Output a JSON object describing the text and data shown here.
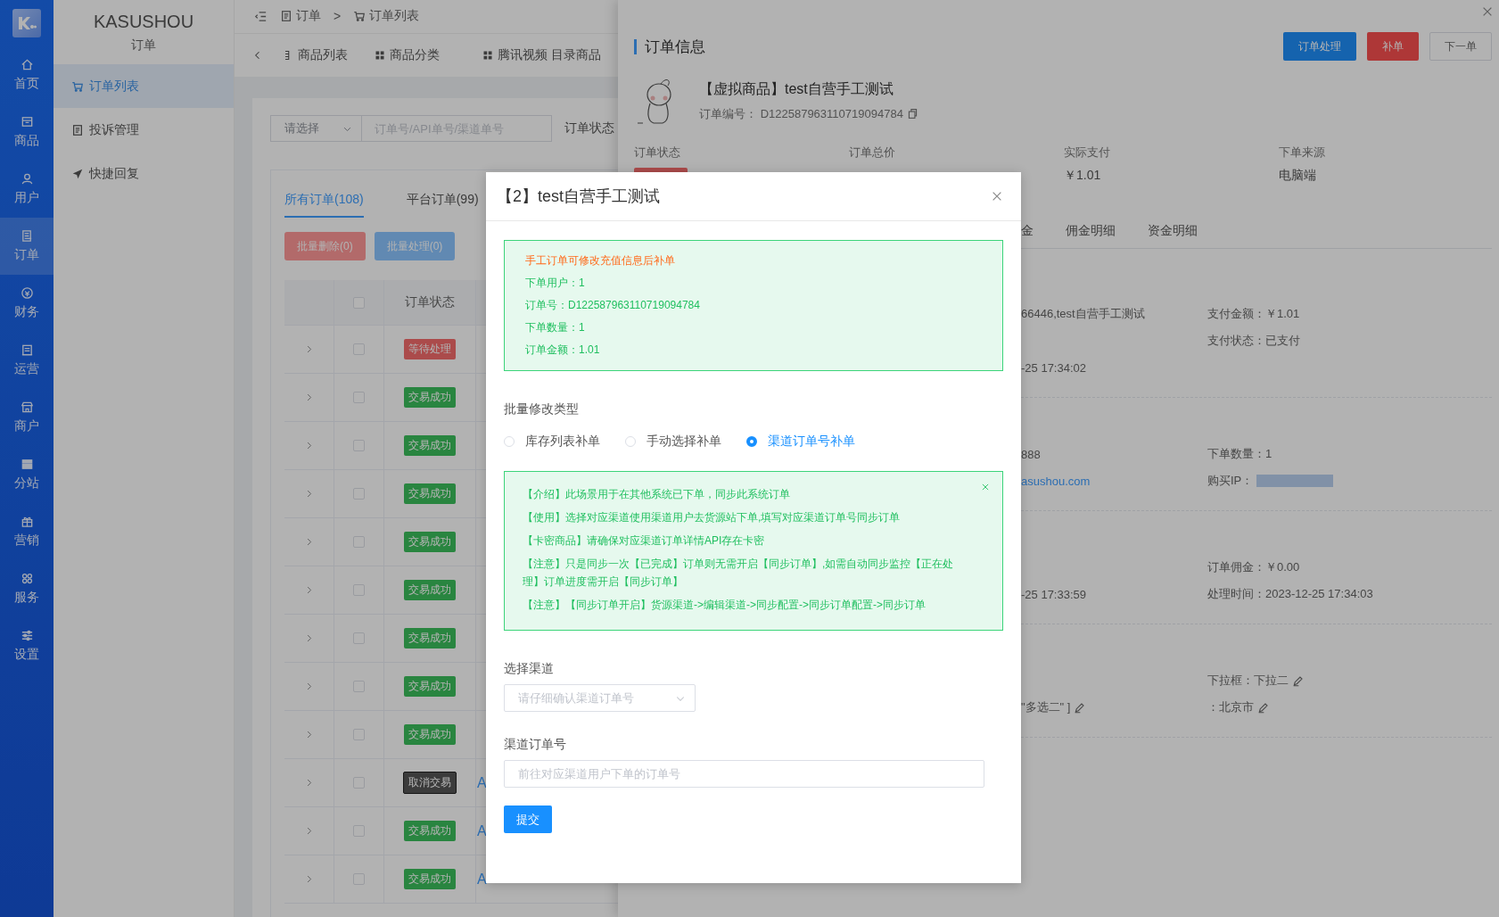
{
  "rail": {
    "items": [
      {
        "label": "首页",
        "selected": false
      },
      {
        "label": "商品",
        "selected": false
      },
      {
        "label": "用户",
        "selected": false
      },
      {
        "label": "订单",
        "selected": true
      },
      {
        "label": "财务",
        "selected": false
      },
      {
        "label": "运营",
        "selected": false
      },
      {
        "label": "商户",
        "selected": false
      },
      {
        "label": "分站",
        "selected": false
      },
      {
        "label": "营销",
        "selected": false
      },
      {
        "label": "服务",
        "selected": false
      },
      {
        "label": "设置",
        "selected": false
      }
    ]
  },
  "subnav": {
    "title": "KASUSHOU",
    "subtitle": "订单",
    "items": [
      {
        "label": "订单列表",
        "selected": true
      },
      {
        "label": "投诉管理",
        "selected": false
      },
      {
        "label": "快捷回复",
        "selected": false
      }
    ]
  },
  "breadcrumb": [
    "订单",
    "订单列表"
  ],
  "breadcrumb_separator": ">",
  "page_tabs": [
    "商品列表",
    "商品分类",
    "腾讯视频 目录商品"
  ],
  "filters": {
    "select_placeholder": "请选择",
    "search_placeholder": "订单号/API单号/渠道单号",
    "status_label": "订单状态"
  },
  "order_tabs": [
    {
      "label": "所有订单(108)",
      "selected": true
    },
    {
      "label": "平台订单(99)",
      "selected": false
    }
  ],
  "batch_buttons": [
    {
      "label": "批量删除(0)",
      "kind": "danger"
    },
    {
      "label": "批量处理(0)",
      "kind": "primary"
    }
  ],
  "table": {
    "columns": [
      "订单状态"
    ],
    "header_checked": false,
    "rows": [
      {
        "status": "等待处理",
        "kind": "pending",
        "checked": false
      },
      {
        "status": "交易成功",
        "kind": "success",
        "checked": false
      },
      {
        "status": "交易成功",
        "kind": "success",
        "checked": false
      },
      {
        "status": "交易成功",
        "kind": "success",
        "checked": false
      },
      {
        "status": "交易成功",
        "kind": "success",
        "checked": false
      },
      {
        "status": "交易成功",
        "kind": "success",
        "checked": false
      },
      {
        "status": "交易成功",
        "kind": "success",
        "checked": false
      },
      {
        "status": "交易成功",
        "kind": "success",
        "checked": false
      },
      {
        "status": "交易成功",
        "kind": "success",
        "checked": false
      },
      {
        "status": "取消交易",
        "kind": "cancelled",
        "checked": false,
        "column_4": "A"
      },
      {
        "status": "交易成功",
        "kind": "success",
        "checked": false,
        "column_4": "A"
      },
      {
        "status": "交易成功",
        "kind": "success",
        "checked": false,
        "column_4": "A"
      }
    ]
  },
  "drawer": {
    "title": "订单信息",
    "buttons": [
      {
        "label": "订单处理",
        "kind": "primary"
      },
      {
        "label": "补单",
        "kind": "danger"
      },
      {
        "label": "下一单",
        "kind": "default"
      }
    ],
    "product": {
      "name": "【虚拟商品】test自营手工测试",
      "order_no_label": "订单编号：",
      "order_no": "D122587963110719094784"
    },
    "stats": [
      {
        "label": "订单状态",
        "kind": "tag"
      },
      {
        "label": "订单总价",
        "kind": "text"
      },
      {
        "label": "实际支付",
        "kind": "text",
        "value": "￥1.01"
      },
      {
        "label": "下单来源",
        "kind": "text",
        "value": "电脑端"
      }
    ],
    "tabs": [
      "金",
      "佣金明细",
      "资金明细"
    ],
    "sections": [
      [
        {
          "left": {
            "text": "66446,test自营手工测试",
            "kind": "text"
          },
          "right": {
            "text": "支付金额：￥1.01",
            "kind": "text"
          }
        },
        {
          "right": {
            "text": "支付状态：已支付",
            "kind": "text"
          }
        },
        {
          "left": {
            "text": "-25 17:34:02",
            "kind": "text"
          }
        }
      ],
      [
        {
          "left": {
            "text": "888",
            "kind": "text"
          },
          "right": {
            "text": "下单数量：1",
            "kind": "text"
          }
        },
        {
          "left": {
            "text": "asushou.com",
            "kind": "link"
          },
          "right": {
            "text": "购买IP：",
            "kind": "masked"
          }
        }
      ],
      [
        {
          "right": {
            "text": "订单佣金：￥0.00",
            "kind": "text"
          }
        },
        {
          "left": {
            "text": "-25 17:33:59",
            "kind": "text"
          },
          "right": {
            "text": "处理时间：2023-12-25 17:34:03",
            "kind": "text"
          }
        }
      ],
      [
        {
          "right": {
            "text": "下拉框：下拉二",
            "kind": "editable"
          }
        },
        {
          "left": {
            "text": "\"多选二\" ]",
            "kind": "editable"
          },
          "right": {
            "text": "：北京市",
            "kind": "editable"
          }
        }
      ]
    ]
  },
  "modal": {
    "title": "【2】test自营手工测试",
    "summary": {
      "headline": "手工订单可修改充值信息后补单",
      "lines": [
        "下单用户：1",
        "订单号：D122587963110719094784",
        "下单数量：1",
        "订单金额：1.01"
      ]
    },
    "type_label": "批量修改类型",
    "types": [
      {
        "label": "库存列表补单",
        "selected": false
      },
      {
        "label": "手动选择补单",
        "selected": false
      },
      {
        "label": "渠道订单号补单",
        "selected": true
      }
    ],
    "notes": [
      "【介绍】此场景用于在其他系统已下单，同步此系统订单",
      "【使用】选择对应渠道使用渠道用户去货源站下单,填写对应渠道订单号同步订单",
      "【卡密商品】请确保对应渠道订单详情API存在卡密",
      "【注意】只是同步一次【已完成】订单则无需开启【同步订单】,如需自动同步监控【正在处理】订单进度需开启【同步订单】",
      "【注意】【同步订单开启】货源渠道->编辑渠道->同步配置->同步订单配置->同步订单"
    ],
    "channel_label": "选择渠道",
    "channel_placeholder": "请仔细确认渠道订单号",
    "order_no_label": "渠道订单号",
    "order_no_placeholder": "前往对应渠道用户下单的订单号",
    "submit": "提交"
  }
}
